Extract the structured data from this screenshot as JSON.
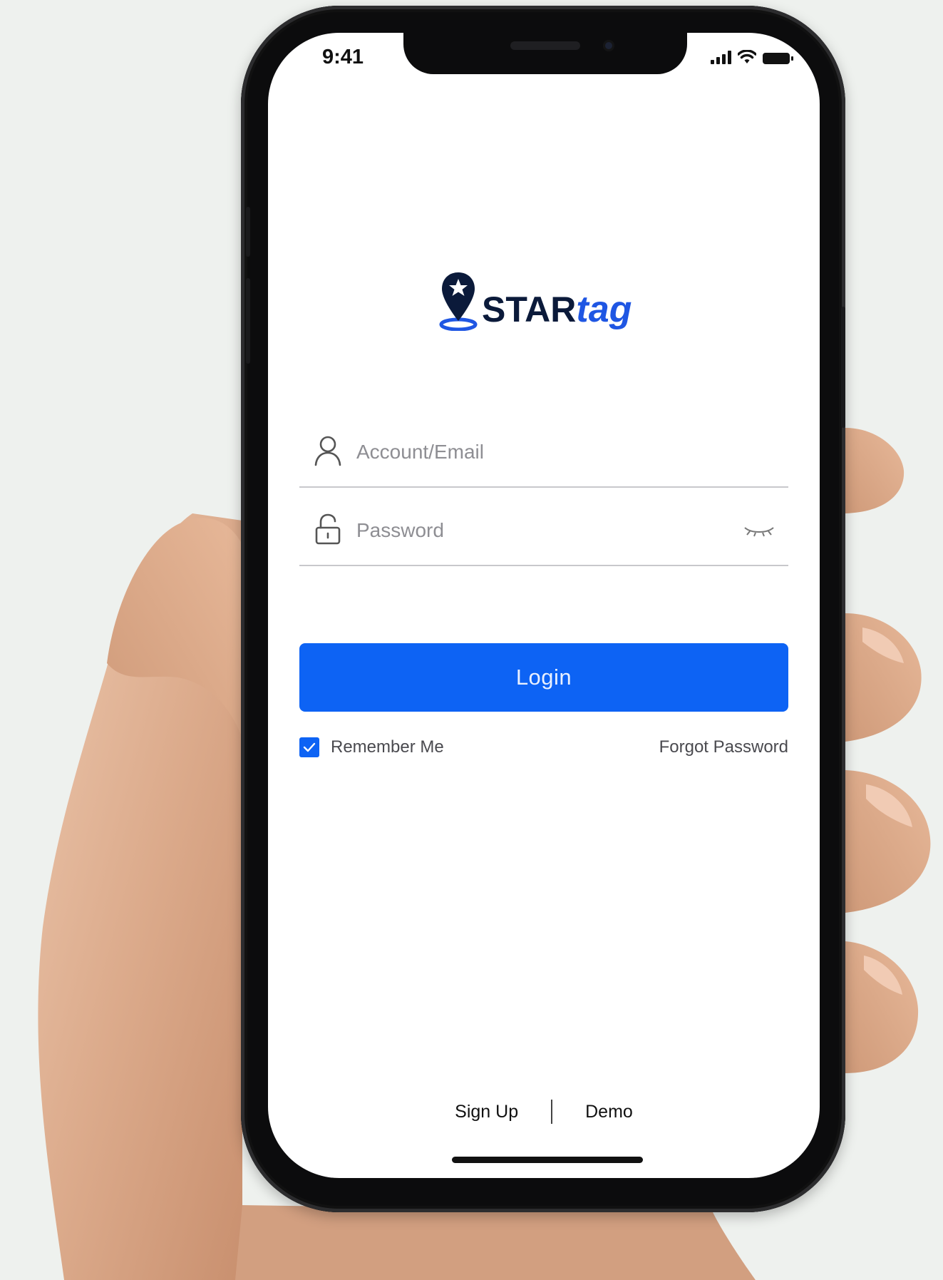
{
  "status_bar": {
    "time": "9:41"
  },
  "brand": {
    "name_bold": "STAR",
    "name_italic": "tag"
  },
  "login_form": {
    "account_placeholder": "Account/Email",
    "password_placeholder": "Password",
    "login_label": "Login",
    "remember_label": "Remember Me",
    "remember_checked": true,
    "forgot_label": "Forgot Password"
  },
  "footer": {
    "signup_label": "Sign Up",
    "demo_label": "Demo"
  },
  "colors": {
    "accent": "#0d63f4",
    "brand_dark": "#0b1a3a",
    "brand_blue": "#1f56e3",
    "background": "#eef1ee"
  },
  "icons": [
    "user-icon",
    "lock-icon",
    "eye-closed-icon",
    "checkmark-icon",
    "signal-icon",
    "wifi-icon",
    "battery-icon",
    "location-pin-star-icon"
  ]
}
